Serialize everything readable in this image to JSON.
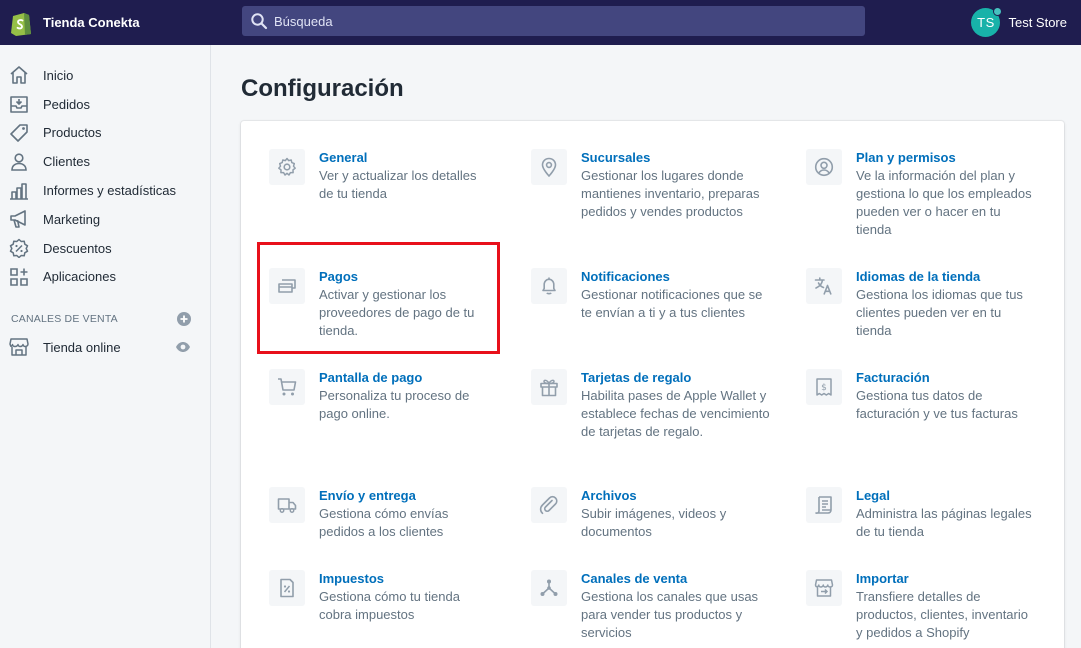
{
  "topbar": {
    "store": "Tienda Conekta",
    "search_placeholder": "Búsqueda",
    "avatar_initials": "TS",
    "account_name": "Test Store",
    "colors": {
      "bar": "#1f1d4f",
      "search": "#43467f",
      "avatar": "#18b2a9"
    }
  },
  "sidebar": {
    "items": [
      {
        "label": "Inicio",
        "icon": "home-icon"
      },
      {
        "label": "Pedidos",
        "icon": "orders-icon"
      },
      {
        "label": "Productos",
        "icon": "tag-icon"
      },
      {
        "label": "Clientes",
        "icon": "customer-icon"
      },
      {
        "label": "Informes y estadísticas",
        "icon": "analytics-icon"
      },
      {
        "label": "Marketing",
        "icon": "megaphone-icon"
      },
      {
        "label": "Descuentos",
        "icon": "discount-icon"
      },
      {
        "label": "Aplicaciones",
        "icon": "apps-icon"
      }
    ],
    "channels_title": "CANALES DE VENTA",
    "online_store": "Tienda online"
  },
  "main": {
    "title": "Configuración",
    "settings": [
      {
        "title": "General",
        "desc": "Ver y actualizar los detalles de tu tienda",
        "icon": "gear-icon"
      },
      {
        "title": "Sucursales",
        "desc": "Gestionar los lugares donde mantienes inventario, preparas pedidos y vendes productos",
        "icon": "location-icon"
      },
      {
        "title": "Plan y permisos",
        "desc": "Ve la información del plan y gestiona lo que los empleados pueden ver o hacer en tu tienda",
        "icon": "user-circle-icon"
      },
      {
        "title": "Pagos",
        "desc": "Activar y gestionar los proveedores de pago de tu tienda.",
        "icon": "payments-icon"
      },
      {
        "title": "Notificaciones",
        "desc": "Gestionar notificaciones que se te envían a ti y a tus clientes",
        "icon": "bell-icon"
      },
      {
        "title": "Idiomas de la tienda",
        "desc": "Gestiona los idiomas que tus clientes pueden ver en tu tienda",
        "icon": "translate-icon"
      },
      {
        "title": "Pantalla de pago",
        "desc": "Personaliza tu proceso de pago online.",
        "icon": "cart-icon"
      },
      {
        "title": "Tarjetas de regalo",
        "desc": "Habilita pases de Apple Wallet y establece fechas de vencimiento de tarjetas de regalo.",
        "icon": "gift-icon"
      },
      {
        "title": "Facturación",
        "desc": "Gestiona tus datos de facturación y ve tus facturas",
        "icon": "billing-icon"
      },
      {
        "title": "Envío y entrega",
        "desc": "Gestiona cómo envías pedidos a los clientes",
        "icon": "truck-icon"
      },
      {
        "title": "Archivos",
        "desc": "Subir imágenes, videos y documentos",
        "icon": "paperclip-icon"
      },
      {
        "title": "Legal",
        "desc": "Administra las páginas legales de tu tienda",
        "icon": "legal-icon"
      },
      {
        "title": "Impuestos",
        "desc": "Gestiona cómo tu tienda cobra impuestos",
        "icon": "tax-icon"
      },
      {
        "title": "Canales de venta",
        "desc": "Gestiona los canales que usas para vender tus productos y servicios",
        "icon": "channels-icon"
      },
      {
        "title": "Importar",
        "desc": "Transfiere detalles de productos, clientes, inventario y pedidos a Shopify",
        "icon": "import-icon"
      }
    ]
  },
  "annotation": {
    "highlight_color": "#e8101b",
    "highlighted_setting": "Pagos"
  }
}
